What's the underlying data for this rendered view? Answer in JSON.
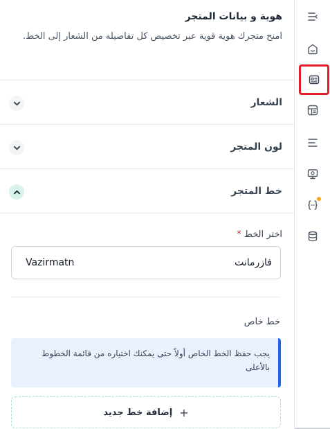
{
  "header": {
    "title": "هوية و بيانات المتجر",
    "description": "امنح متجرك هوية قوية عبر تخصيص كل تفاصيله من الشعار إلى الخط."
  },
  "sections": [
    {
      "label": "الشعار",
      "expanded": false
    },
    {
      "label": "لون المتجر",
      "expanded": false
    },
    {
      "label": "خط المتجر",
      "expanded": true
    }
  ],
  "font_field": {
    "label": "اختر الخط",
    "required_mark": "*",
    "selected_ar": "فازرمانت",
    "selected_en": "Vazirmatn"
  },
  "custom_font": {
    "label": "خط خاص",
    "notice": "يجب حفظ الخط الخاص أولاً حتى يمكنك اختياره من قائمة الخطوط بالأعلى",
    "add_label": "إضافة خط جديد",
    "add_icon": "+"
  },
  "rail": {
    "icons": [
      "collapse-icon",
      "home-icon",
      "identity-card-icon",
      "layout-icon",
      "list-icon",
      "settings-monitor-icon",
      "code-icon",
      "database-icon"
    ],
    "active": "identity-card-icon",
    "code_badge_color": "#f5a623"
  },
  "colors": {
    "accent_highlight": "#e11d2a",
    "info_border": "#2563eb",
    "info_bg": "#eaf1fe",
    "expanded_chevron_bg": "#d8f3ea"
  }
}
